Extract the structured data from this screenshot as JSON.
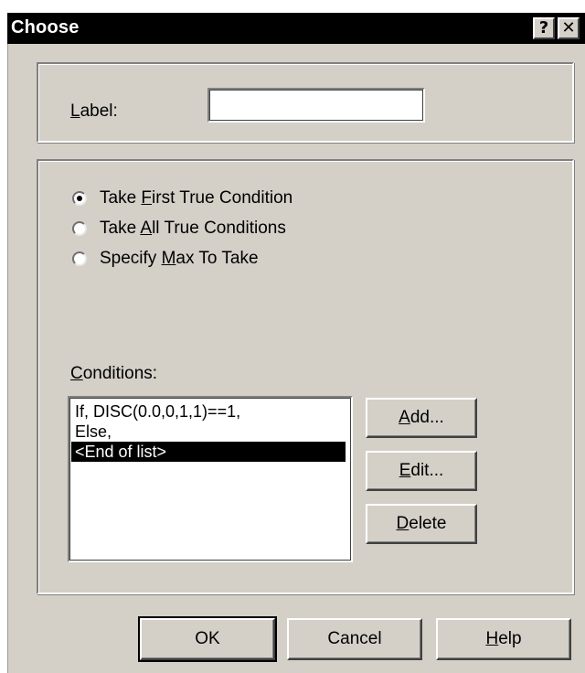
{
  "window": {
    "title": "Choose",
    "help_glyph": "?",
    "close_glyph": "✕"
  },
  "label_group": {
    "caption_prefix": "",
    "caption_mnemonic": "L",
    "caption_rest": "abel:",
    "input_value": ""
  },
  "options": [
    {
      "pre": "Take ",
      "mn": "F",
      "post": "irst True Condition",
      "checked": true
    },
    {
      "pre": "Take ",
      "mn": "A",
      "post": "ll True Conditions",
      "checked": false
    },
    {
      "pre": "Specify ",
      "mn": "M",
      "post": "ax To Take",
      "checked": false
    }
  ],
  "conditions": {
    "caption_mnemonic": "C",
    "caption_rest": "onditions:",
    "items": [
      {
        "text": "If, DISC(0.0,0,1,1)==1,",
        "selected": false
      },
      {
        "text": "Else,",
        "selected": false
      },
      {
        "text": "<End of list>",
        "selected": true
      }
    ]
  },
  "side_buttons": {
    "add": {
      "mn": "A",
      "rest": "dd..."
    },
    "edit": {
      "mn": "E",
      "rest": "dit..."
    },
    "delete": {
      "mn": "D",
      "rest": "elete"
    }
  },
  "footer": {
    "ok": "OK",
    "cancel": "Cancel",
    "help_mn": "H",
    "help_rest": "elp"
  },
  "colors": {
    "face": "#d4d0c8",
    "title_bar": "#000000",
    "selection": "#000000"
  }
}
